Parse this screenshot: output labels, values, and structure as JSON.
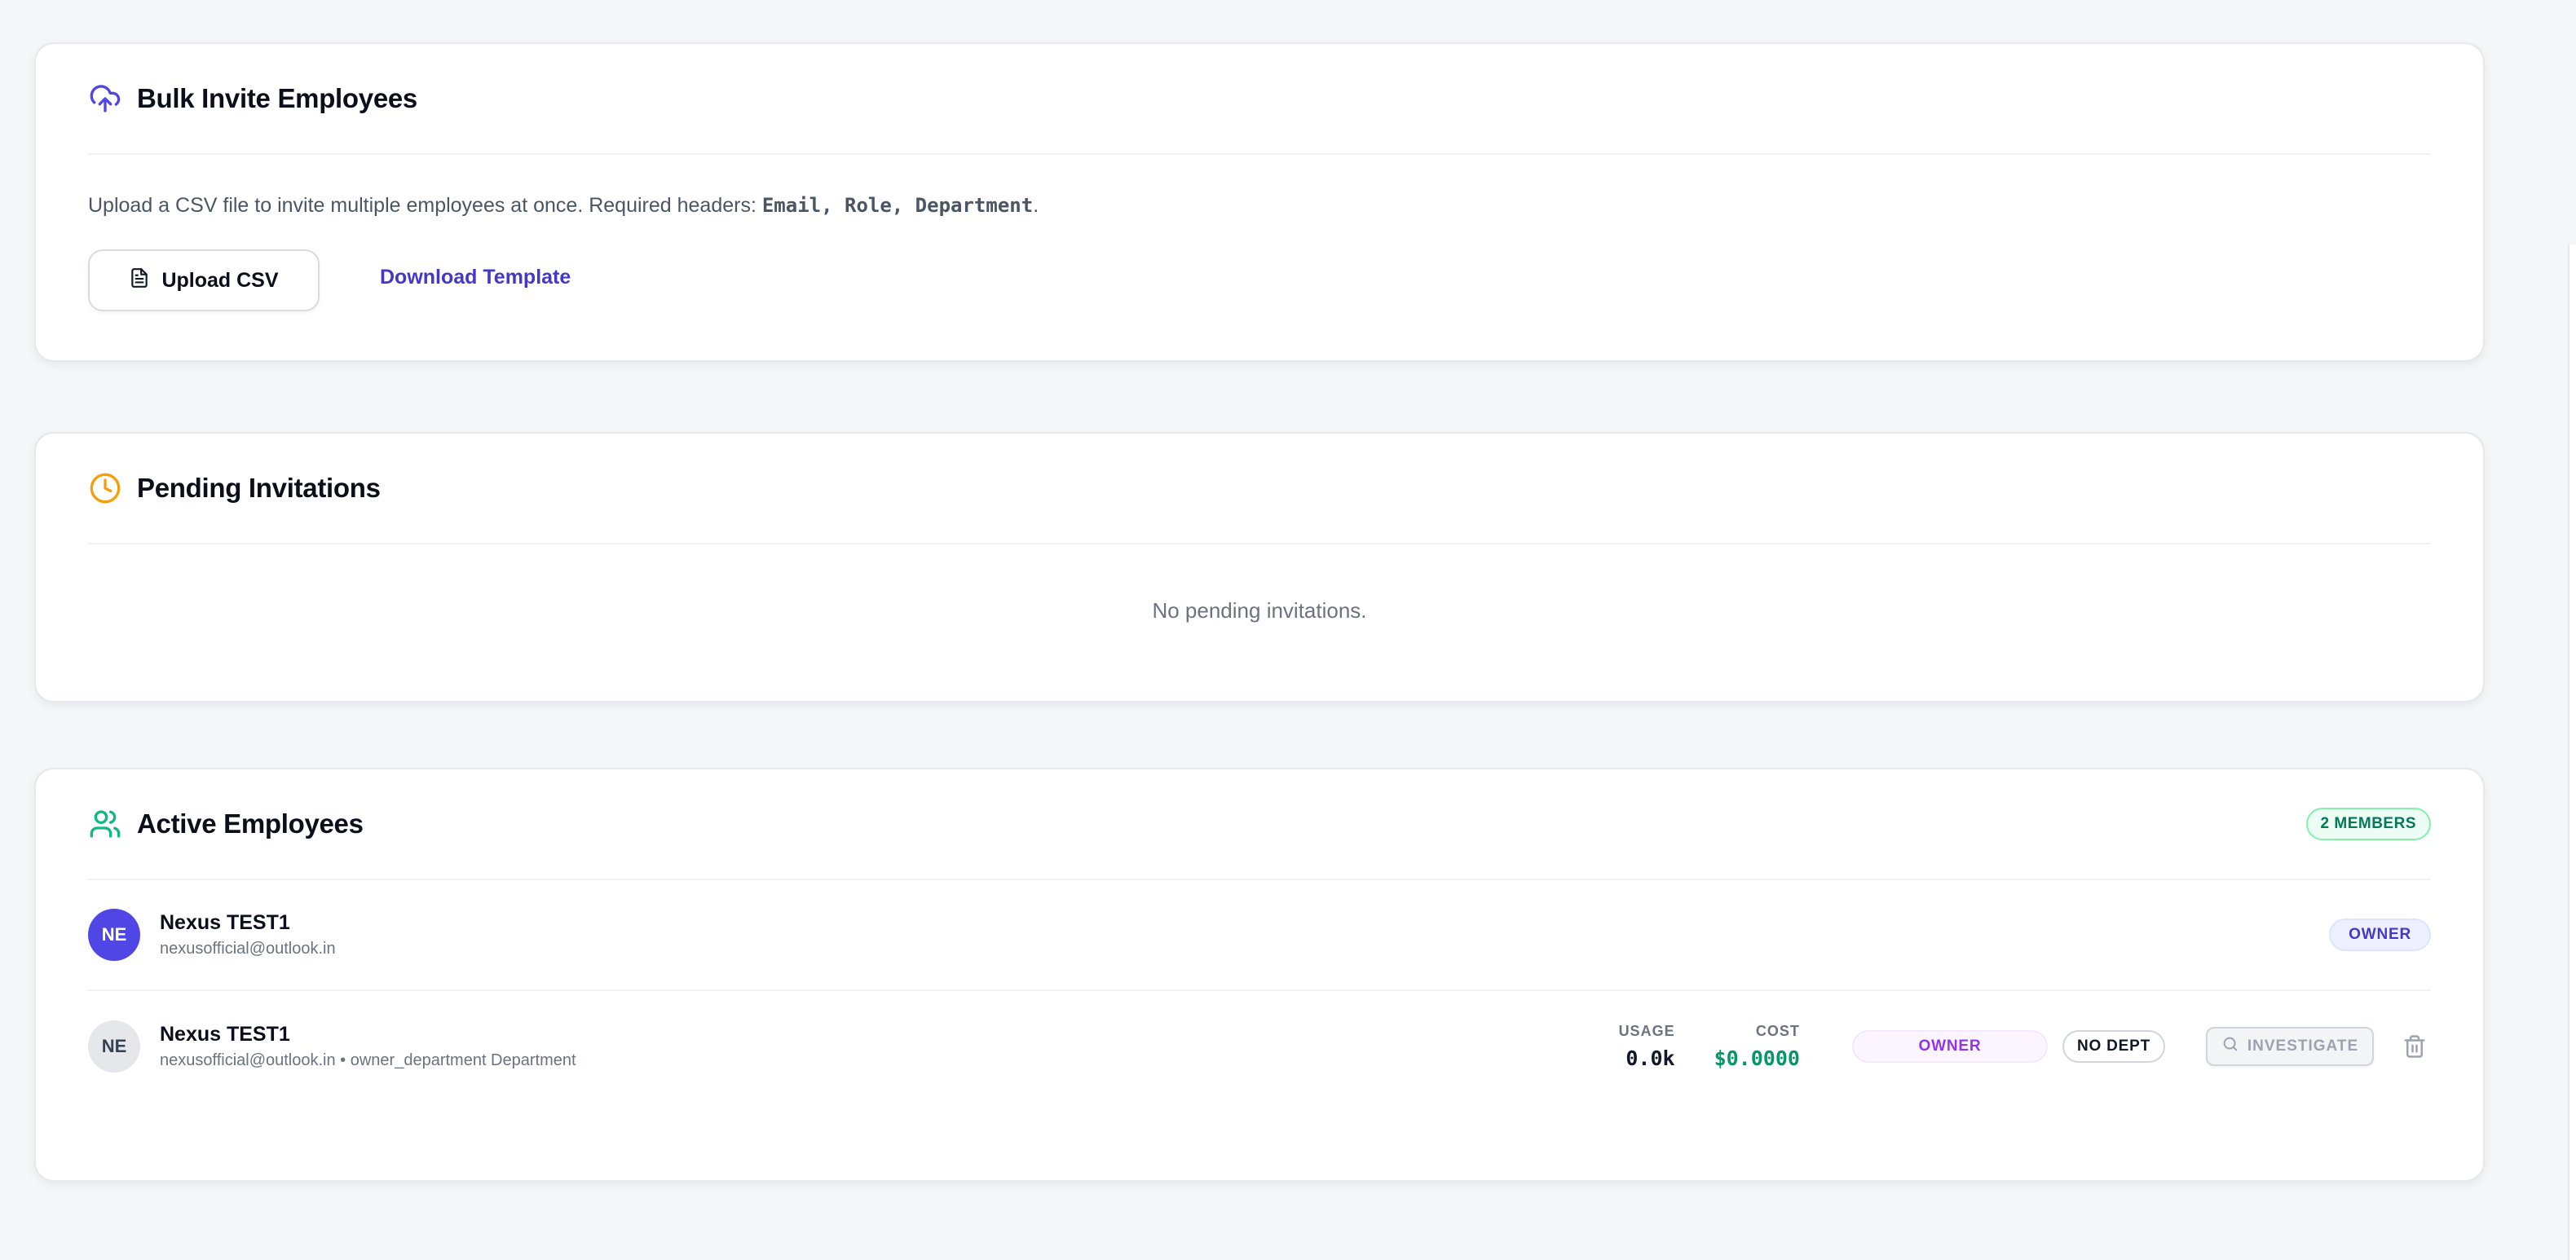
{
  "colors": {
    "accent": "#4338ca",
    "upload_icon": "#4f46e5",
    "clock_icon": "#f59e0b",
    "users_icon": "#10b981",
    "cost_green": "#059669"
  },
  "bulk": {
    "icon": "cloud-upload-icon",
    "title": "Bulk Invite Employees",
    "description_prefix": "Upload a CSV file to invite multiple employees at once. Required headers: ",
    "description_headers": "Email, Role, Department",
    "description_suffix": ".",
    "upload_button": "Upload CSV",
    "upload_icon": "file-icon",
    "download_link": "Download Template"
  },
  "pending": {
    "icon": "clock-icon",
    "title": "Pending Invitations",
    "empty_text": "No pending invitations."
  },
  "active": {
    "icon": "users-icon",
    "title": "Active Employees",
    "member_badge": "2 MEMBERS",
    "employees": [
      {
        "initials": "NE",
        "name": "Nexus TEST1",
        "subtitle": "nexusofficial@outlook.in",
        "role": "OWNER"
      },
      {
        "initials": "NE",
        "name": "Nexus TEST1",
        "subtitle": "nexusofficial@outlook.in • owner_department Department",
        "usage_label": "USAGE",
        "usage_value": "0.0k",
        "cost_label": "COST",
        "cost_value": "$0.0000",
        "role": "OWNER",
        "department": "NO DEPT",
        "investigate_label": "INVESTIGATE",
        "investigate_icon": "search-icon",
        "delete_icon": "trash-icon"
      }
    ]
  }
}
